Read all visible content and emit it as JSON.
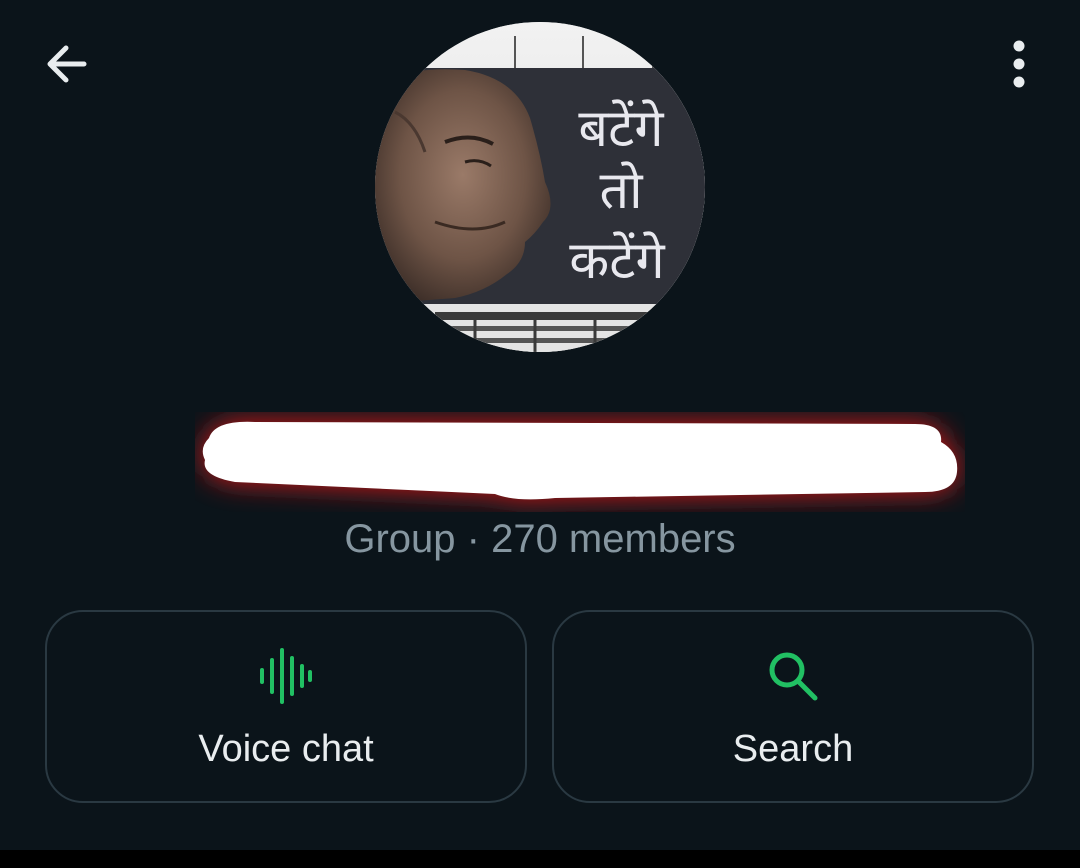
{
  "header": {
    "back_icon": "arrow-left-icon",
    "menu_icon": "more-vert-icon"
  },
  "group": {
    "name": "",
    "subtitle": "Group · 270 members",
    "avatar": {
      "icon": "group-photo",
      "poster_text": [
        "बटेंगे",
        "तो",
        "कटेंगे"
      ]
    }
  },
  "actions": [
    {
      "label": "Voice chat",
      "icon": "waveform-icon"
    },
    {
      "label": "Search",
      "icon": "search-icon"
    }
  ],
  "colors": {
    "background": "#0b141a",
    "accent": "#21c063",
    "text_primary": "#e9edef",
    "text_secondary": "#8696a0",
    "card_border": "#2a3942",
    "redaction_glow": "#e01e1e"
  }
}
